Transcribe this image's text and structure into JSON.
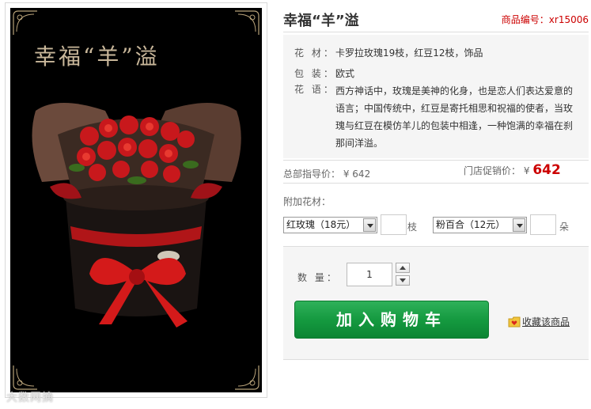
{
  "image": {
    "title": "幸福“羊”溢",
    "watermark": "大数网摘"
  },
  "product": {
    "title": "幸福“羊”溢",
    "code_label": "商品编号：",
    "code_value": "xr15006"
  },
  "info": {
    "flower_label": "花 材：",
    "flower_value": "卡罗拉玫瑰19枝，红豆12枝，饰品",
    "package_label": "包 装：",
    "package_value": "欧式",
    "language_label": "花 语：",
    "language_value": "西方神话中，玫瑰是美神的化身，也是恋人们表达爱意的语言；中国传统中，红豆是寄托相思和祝福的使者，当玫瑰与红豆在模仿羊儿的包装中相逢，一种饱满的幸福在刹那间洋溢。"
  },
  "price": {
    "guide_label": "总部指导价：",
    "guide_value": "¥ 642",
    "promo_label": "门店促销价：",
    "promo_currency": "¥",
    "promo_value": "642",
    "promo_color": "#cc0000"
  },
  "addon": {
    "label": "附加花材：",
    "select1_value": "红玫瑰（18元）",
    "select1_unit": "枝",
    "select2_value": "粉百合（12元）",
    "select2_unit": "朵"
  },
  "purchase": {
    "qty_label": "数 量：",
    "qty_value": "1",
    "cart_label": "加入购物车",
    "cart_color": "#159a40",
    "favorite_label": "收藏该商品"
  }
}
